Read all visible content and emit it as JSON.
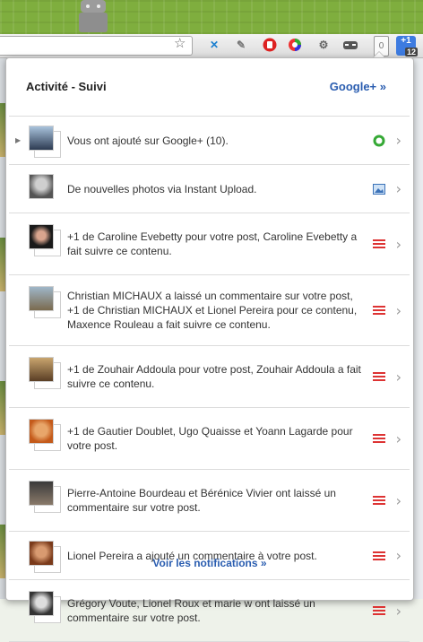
{
  "toolbar": {
    "gplus_count": "0",
    "badge_label": "+1",
    "badge_count": "12"
  },
  "popup": {
    "title": "Activité - Suivi",
    "gplus_link": "Google+ »",
    "footer_link": "Voir les notifications »"
  },
  "notifications": [
    {
      "text": "Vous ont ajouté sur Google+ (10).",
      "icon": "green-circle-icon"
    },
    {
      "text": "De nouvelles photos via Instant Upload.",
      "icon": "photo-icon"
    },
    {
      "text": "+1 de Caroline Evebetty pour votre post, Caroline Evebetty a fait suivre ce contenu.",
      "icon": "list-icon"
    },
    {
      "text": "Christian MICHAUX a laissé un commentaire sur votre post, +1 de Christian MICHAUX et Lionel Pereira pour ce contenu, Maxence Rouleau a fait suivre ce contenu.",
      "icon": "list-icon"
    },
    {
      "text": "+1 de Zouhair Addoula pour votre post, Zouhair Addoula a fait suivre ce contenu.",
      "icon": "list-icon"
    },
    {
      "text": "+1 de Gautier Doublet, Ugo Quaisse et Yoann Lagarde pour votre post.",
      "icon": "list-icon"
    },
    {
      "text": "Pierre-Antoine Bourdeau et Bérénice Vivier ont laissé un commentaire sur votre post.",
      "icon": "list-icon"
    },
    {
      "text": "Lionel Pereira a ajouté un commentaire à votre post.",
      "icon": "list-icon"
    },
    {
      "text": "Grégory Voute, Lionel Roux et marie w ont laissé un commentaire sur votre post.",
      "icon": "list-icon"
    }
  ],
  "colors": {
    "link": "#2a5db0",
    "accent_red": "#dd3333",
    "accent_green": "#35a935"
  }
}
